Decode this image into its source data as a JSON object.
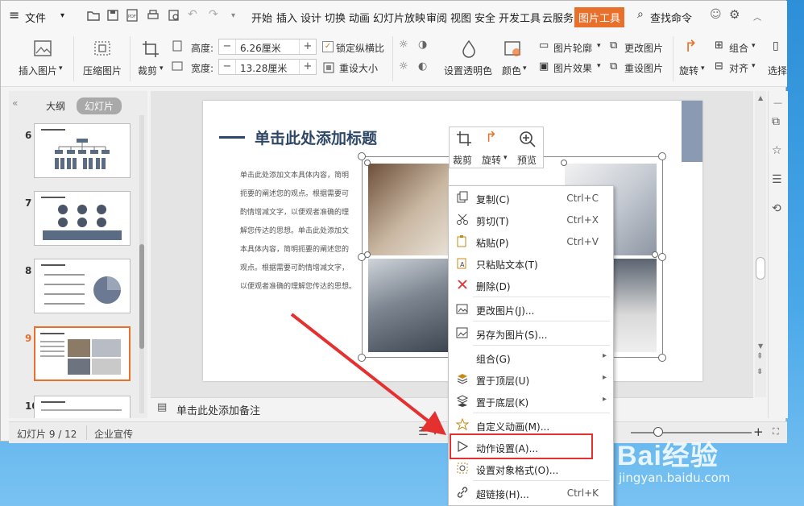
{
  "menubar": {
    "file": "文件",
    "tabs": [
      "开始",
      "插入",
      "设计",
      "切换",
      "动画",
      "幻灯片放映",
      "审阅",
      "视图",
      "安全",
      "开发工具",
      "云服务",
      "图片工具"
    ],
    "active_tab": "图片工具",
    "search": "查找命令"
  },
  "ribbon": {
    "insert_picture": "插入图片",
    "compress": "压缩图片",
    "crop": "裁剪",
    "height_label": "高度:",
    "height_value": "6.26厘米",
    "width_label": "宽度:",
    "width_value": "13.28厘米",
    "lock_ratio": "锁定纵横比",
    "reset_size": "重设大小",
    "transparency": "设置透明色",
    "color": "颜色",
    "outline": "图片轮廓",
    "effects": "图片效果",
    "change_picture": "更改图片",
    "reset_picture": "重设图片",
    "rotate": "旋转",
    "group": "组合",
    "align": "对齐",
    "select": "选择"
  },
  "left_panel": {
    "tab_outline": "大纲",
    "tab_slides": "幻灯片",
    "slides": [
      "6",
      "7",
      "8",
      "9",
      "10"
    ],
    "active_slide": "9"
  },
  "slide": {
    "title": "单击此处添加标题",
    "body": [
      "单击此处添加文本具体内容，简明",
      "扼要的阐述您的观点。根据需要可",
      "酌情增减文字，以便观者准确的理",
      "解您传达的思想。单击此处添加文",
      "本具体内容，简明扼要的阐述您的",
      "观点。根据需要可酌情增减文字，",
      "以便观者准确的理解您传达的思想。"
    ]
  },
  "mini_toolbar": {
    "crop": "裁剪",
    "rotate": "旋转",
    "preview": "预览"
  },
  "notes": {
    "placeholder": "单击此处添加备注"
  },
  "status": {
    "slide_info": "幻灯片 9 / 12",
    "theme": "企业宣传"
  },
  "context_menu": {
    "items": [
      {
        "label": "复制(C)",
        "shortcut": "Ctrl+C",
        "icon": "copy-icon"
      },
      {
        "label": "剪切(T)",
        "shortcut": "Ctrl+X",
        "icon": "cut-icon"
      },
      {
        "label": "粘贴(P)",
        "shortcut": "Ctrl+V",
        "icon": "paste-icon"
      },
      {
        "label": "只粘贴文本(T)",
        "shortcut": "",
        "icon": "paste-text-icon"
      },
      {
        "label": "删除(D)",
        "shortcut": "",
        "icon": "delete-icon"
      },
      {
        "label": "更改图片(J)...",
        "shortcut": "",
        "icon": "change-picture-icon"
      },
      {
        "label": "另存为图片(S)...",
        "shortcut": "",
        "icon": "save-picture-icon"
      },
      {
        "label": "组合(G)",
        "shortcut": "",
        "icon": "",
        "submenu": true
      },
      {
        "label": "置于顶层(U)",
        "shortcut": "",
        "icon": "bring-front-icon",
        "submenu": true
      },
      {
        "label": "置于底层(K)",
        "shortcut": "",
        "icon": "send-back-icon",
        "submenu": true
      },
      {
        "label": "自定义动画(M)...",
        "shortcut": "",
        "icon": "animation-icon"
      },
      {
        "label": "动作设置(A)...",
        "shortcut": "",
        "icon": "action-icon"
      },
      {
        "label": "设置对象格式(O)...",
        "shortcut": "",
        "icon": "format-object-icon"
      },
      {
        "label": "超链接(H)...",
        "shortcut": "Ctrl+K",
        "icon": "hyperlink-icon"
      }
    ],
    "highlighted": "动作设置(A)..."
  },
  "watermark": {
    "brand": "Bai经验",
    "url": "jingyan.baidu.com"
  },
  "colors": {
    "accent": "#e53030",
    "active_tab_bg": "#e8702a",
    "title_blue": "#2f4766"
  }
}
